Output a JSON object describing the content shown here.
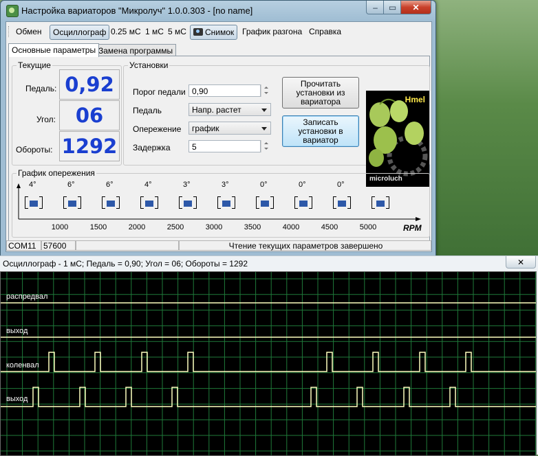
{
  "window": {
    "title": "Настройка вариаторов \"Микролуч\" 1.0.0.303 - [no name]",
    "min_glyph": "–",
    "max_glyph": "▭",
    "close_glyph": "✕"
  },
  "toolbar": {
    "exchange": "Обмен",
    "oscilloscope": "Осциллограф",
    "t025": "0.25 мС",
    "t1": "1 мС",
    "t5": "5 мС",
    "snapshot": "Снимок",
    "accel_graph": "График разгона",
    "help": "Справка"
  },
  "tabs": {
    "main": "Основные параметры",
    "program": "Замена программы"
  },
  "current": {
    "group_label": "Текущие",
    "pedal_label": "Педаль:",
    "pedal_value": "0,92",
    "angle_label": "Угол:",
    "angle_value": "06",
    "rpm_label": "Обороты:",
    "rpm_value": "1292"
  },
  "settings": {
    "group_label": "Установки",
    "pedal_threshold_label": "Порог педали",
    "pedal_threshold_value": "0,90",
    "pedal_label": "Педаль",
    "pedal_value": "Напр. растет",
    "advance_label": "Опережение",
    "advance_value": "график",
    "delay_label": "Задержка",
    "delay_value": "5",
    "read_button": "Прочитать\nустановки из\nвариатора",
    "write_button": "Записать\nустановки в\nвариатор"
  },
  "logo": {
    "name": "Hmel",
    "brand": "microluch"
  },
  "advance_graph": {
    "group_label": "График опережения",
    "angles": [
      "4°",
      "6°",
      "6°",
      "4°",
      "3°",
      "3°",
      "0°",
      "0°",
      "0°",
      "0°"
    ],
    "rpm_ticks": [
      "1000",
      "1500",
      "2000",
      "2500",
      "3000",
      "3500",
      "4000",
      "4500",
      "5000"
    ],
    "axis_unit": "RPM"
  },
  "status": {
    "port": "COM11",
    "baud": "57600",
    "message": "Чтение текущих параметров завершено"
  },
  "scope": {
    "title": "Осциллограф - 1 мС; Педаль = 0,90; Угол = 06; Обороты = 1292",
    "close_glyph": "✕",
    "channels": [
      "распредвал",
      "выход",
      "коленвал",
      "выход"
    ],
    "trace_color": "#ffffc0",
    "grid_color": "#1f7a3a"
  },
  "chart_data": {
    "type": "line",
    "title": "",
    "series": [
      {
        "name": "распредвал",
        "pulses": []
      },
      {
        "name": "выход",
        "pulses": []
      },
      {
        "name": "коленвал",
        "pulses": [
          70,
          137,
          205,
          272,
          474,
          541,
          609,
          676
        ]
      },
      {
        "name": "выход",
        "pulses": [
          47,
          115,
          182,
          249,
          451,
          518,
          586,
          653
        ]
      }
    ],
    "pulse_width": 8
  }
}
